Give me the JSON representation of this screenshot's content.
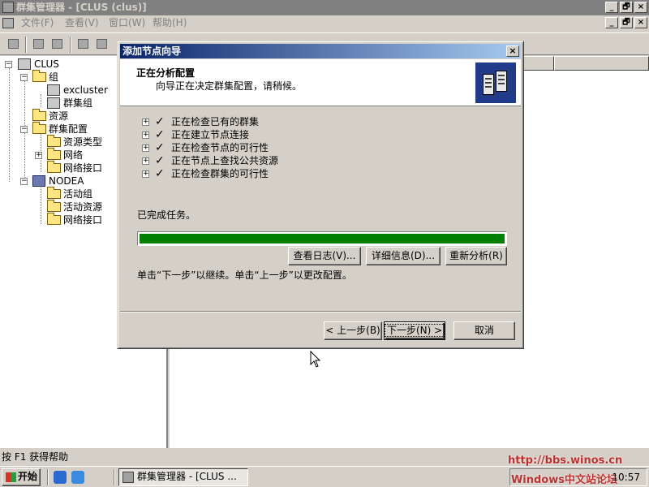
{
  "window": {
    "title": "群集管理器 - [CLUS (clus)]",
    "app_icon": "cluster-admin-icon",
    "buttons": {
      "minimize": "_",
      "restore": "🗗",
      "close": "×"
    }
  },
  "menubar": {
    "items": [
      "文件(F)",
      "查看(V)",
      "窗口(W)",
      "帮助(H)"
    ],
    "mdi_buttons": {
      "minimize": "_",
      "restore": "🗗",
      "close": "×"
    }
  },
  "tree": {
    "root": "CLUS",
    "groups": "组",
    "group_children": [
      "excluster",
      "群集组"
    ],
    "resources": "资源",
    "cluster_config": "群集配置",
    "config_children": [
      "资源类型",
      "网络",
      "网络接口"
    ],
    "node": "NODEA",
    "node_children": [
      "活动组",
      "活动资源",
      "网络接口"
    ]
  },
  "dialog": {
    "title": "添加节点向导",
    "close_symbol": "×",
    "header_title": "正在分析配置",
    "header_subtitle": "向导正在决定群集配置，请稍候。",
    "expander_symbol": "+",
    "check_symbol": "✓",
    "steps": [
      "正在检查已有的群集",
      "正在建立节点连接",
      "正在检查节点的可行性",
      "正在节点上查找公共资源",
      "正在检查群集的可行性"
    ],
    "status": "已完成任务。",
    "progress_fraction": 1.0,
    "buttons": {
      "view_log": "查看日志(V)...",
      "details": "详细信息(D)...",
      "reanalyze": "重新分析(R)",
      "back": "< 上一步(B)",
      "next": "下一步(N) >",
      "cancel": "取消"
    },
    "hint": "单击“下一步”以继续。单击“上一步”以更改配置。"
  },
  "statusbar": {
    "text": "按 F1 获得帮助"
  },
  "taskbar": {
    "start": "开始",
    "task": "群集管理器 - [CLUS ...",
    "clock": "10:57",
    "watermark_url": "http://bbs.winos.cn",
    "watermark_name": "Windows中文站论坛"
  },
  "colors": {
    "titlebar_active": "#0a246a",
    "titlebar_gradient_end": "#a6caf0",
    "progress_fill": "#008000",
    "face": "#d4d0c8"
  }
}
